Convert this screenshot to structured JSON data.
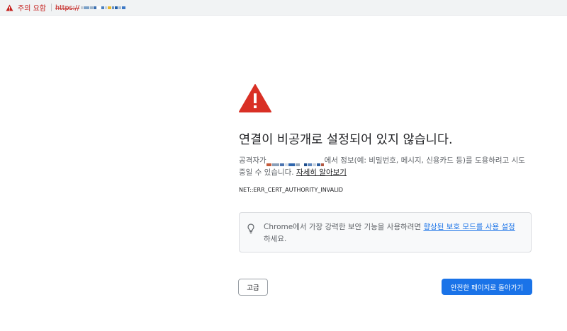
{
  "omnibox": {
    "security_label": "주의 요함",
    "url_scheme": "https://",
    "icon": "warning-triangle-icon"
  },
  "interstitial": {
    "icon": "warning-triangle-icon",
    "title": "연결이 비공개로 설정되어 있지 않습니다.",
    "desc_prefix": "공격자가",
    "desc_mid": "에서 정보(예: 비밀번호, 메시지, 신용카드 등)를 도용하려고 시도 중일 수 있습니다.",
    "learn_more": "자세히 알아보기",
    "error_code": "NET::ERR_CERT_AUTHORITY_INVALID"
  },
  "tip": {
    "icon": "lightbulb-icon",
    "text_before": "Chrome에서 가장 강력한 보안 기능을 사용하려면 ",
    "link": "향상된 보호 모드를 사용 설정",
    "text_after": "하세요."
  },
  "buttons": {
    "advanced": "고급",
    "back_to_safety": "안전한 페이지로 돌아가기"
  },
  "colors": {
    "warning_red": "#d93025",
    "primary_blue": "#1a73e8"
  }
}
